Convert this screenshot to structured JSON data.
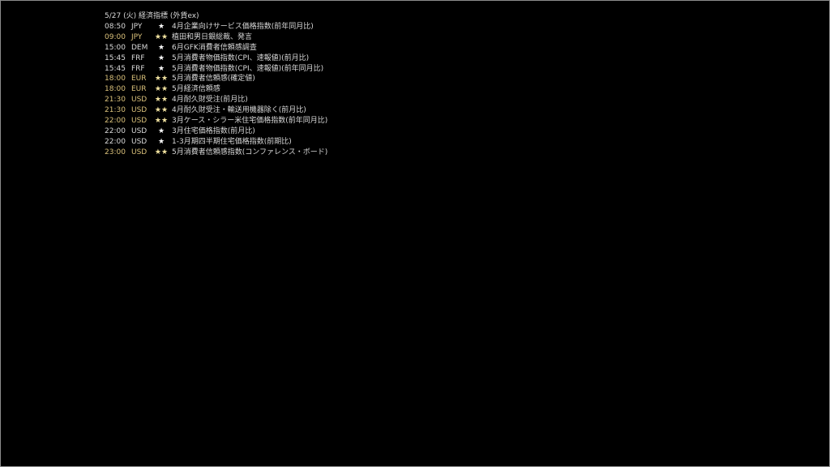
{
  "title": "5/27 (火) 経済指標 (外貨ex)",
  "colors": {
    "background": "#000000",
    "text": "#d9d9d9",
    "highlight": "#d9c07a",
    "border": "#8c8c8c"
  },
  "rows": [
    {
      "time": "08:50",
      "currency": "JPY",
      "stars": "★",
      "name": "4月企業向けサービス価格指数(前年同月比)",
      "highlight": false
    },
    {
      "time": "09:00",
      "currency": "JPY",
      "stars": "★★",
      "name": "植田和男日銀総裁、発言",
      "highlight": true
    },
    {
      "time": "15:00",
      "currency": "DEM",
      "stars": "★",
      "name": "6月GFK消費者信頼感調査",
      "highlight": false
    },
    {
      "time": "15:45",
      "currency": "FRF",
      "stars": "★",
      "name": "5月消費者物価指数(CPI、速報値)(前月比)",
      "highlight": false
    },
    {
      "time": "15:45",
      "currency": "FRF",
      "stars": "★",
      "name": "5月消費者物価指数(CPI、速報値)(前年同月比)",
      "highlight": false
    },
    {
      "time": "18:00",
      "currency": "EUR",
      "stars": "★★",
      "name": "5月消費者信頼感(確定値)",
      "highlight": true
    },
    {
      "time": "18:00",
      "currency": "EUR",
      "stars": "★★",
      "name": "5月経済信頼感",
      "highlight": true
    },
    {
      "time": "21:30",
      "currency": "USD",
      "stars": "★★",
      "name": "4月耐久財受注(前月比)",
      "highlight": true
    },
    {
      "time": "21:30",
      "currency": "USD",
      "stars": "★★",
      "name": "4月耐久財受注・輸送用機器除く(前月比)",
      "highlight": true
    },
    {
      "time": "22:00",
      "currency": "USD",
      "stars": "★★",
      "name": "3月ケース・シラー米住宅価格指数(前年同月比)",
      "highlight": true
    },
    {
      "time": "22:00",
      "currency": "USD",
      "stars": "★",
      "name": "3月住宅価格指数(前月比)",
      "highlight": false
    },
    {
      "time": "22:00",
      "currency": "USD",
      "stars": "★",
      "name": "1-3月期四半期住宅価格指数(前期比)",
      "highlight": false
    },
    {
      "time": "23:00",
      "currency": "USD",
      "stars": "★★",
      "name": "5月消費者信頼感指数(コンファレンス・ボード)",
      "highlight": true
    }
  ]
}
